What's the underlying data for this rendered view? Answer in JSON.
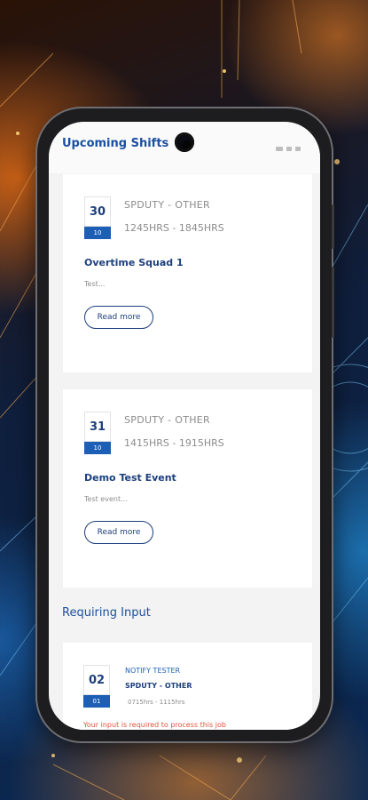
{
  "header": {
    "title": "Upcoming Shifts"
  },
  "shifts": [
    {
      "day": "30",
      "month": "10",
      "category": "SPDUTY - OTHER",
      "time": "1245HRS - 1845HRS",
      "title": "Overtime Squad 1",
      "description": "Test...",
      "button_label": "Read more"
    },
    {
      "day": "31",
      "month": "10",
      "category": "SPDUTY - OTHER",
      "time": "1415HRS - 1915HRS",
      "title": "Demo Test Event",
      "description": "Test event...",
      "button_label": "Read more"
    }
  ],
  "requiring_input": {
    "section_title": "Requiring Input",
    "item": {
      "day": "02",
      "month": "01",
      "notify": "NOTIFY TESTER",
      "category": "SPDUTY - OTHER",
      "time": "0715hrs - 1115hrs",
      "alert": "Your input is required to process this job"
    }
  },
  "colors": {
    "accent": "#1c4fa0",
    "date_badge": "#1c5fb5",
    "alert": "#e0523a"
  }
}
